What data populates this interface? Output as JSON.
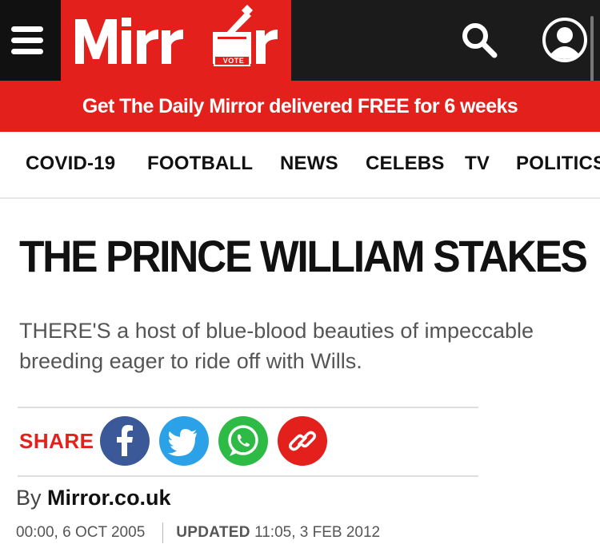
{
  "header": {
    "logo_text": "Mirr r",
    "logo_vote_label": "VOTE",
    "colors": {
      "brand": "#e3201b",
      "header_bg": "#1b1b1b"
    },
    "icons": [
      "menu-icon",
      "search-icon",
      "account-icon"
    ]
  },
  "promo": {
    "text": "Get The Daily Mirror delivered FREE for 6 weeks"
  },
  "nav": {
    "items": [
      {
        "label": "COVID-19"
      },
      {
        "label": "FOOTBALL"
      },
      {
        "label": "NEWS"
      },
      {
        "label": "CELEBS"
      },
      {
        "label": "TV"
      },
      {
        "label": "POLITICS"
      }
    ]
  },
  "article": {
    "headline": "THE PRINCE WILLIAM STAKES",
    "standfirst": "THERE'S a host of blue-blood beauties of impeccable breeding eager to ride off with Wills.",
    "share": {
      "label": "SHARE",
      "buttons": [
        {
          "icon": "facebook-icon",
          "color": "#3b5998"
        },
        {
          "icon": "twitter-icon",
          "color": "#1da1f2"
        },
        {
          "icon": "whatsapp-icon",
          "color": "#25d366"
        },
        {
          "icon": "link-icon",
          "color": "#e3201b"
        }
      ]
    },
    "byline": {
      "prefix": "By",
      "author": "Mirror.co.uk"
    },
    "published": "00:00, 6 OCT 2005",
    "updated_label": "UPDATED",
    "updated": "11:05, 3 FEB 2012"
  }
}
